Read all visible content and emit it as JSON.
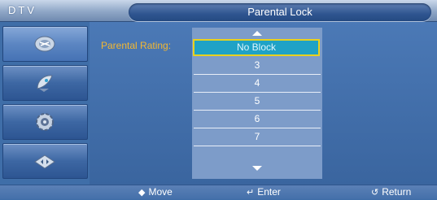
{
  "header": {
    "mode_label": "DTV",
    "title": "Parental Lock"
  },
  "sidebar": {
    "items": [
      {
        "icon": "satellite-dish-icon",
        "active": true
      },
      {
        "icon": "tv-antenna-icon",
        "active": false
      },
      {
        "icon": "gear-icon",
        "active": false
      },
      {
        "icon": "input-arrows-icon",
        "active": false
      }
    ]
  },
  "content": {
    "rating_label": "Parental Rating:",
    "options": [
      {
        "label": "No Block",
        "selected": true
      },
      {
        "label": "3",
        "selected": false
      },
      {
        "label": "4",
        "selected": false
      },
      {
        "label": "5",
        "selected": false
      },
      {
        "label": "6",
        "selected": false
      },
      {
        "label": "7",
        "selected": false
      }
    ],
    "scroll_up_icon": "chevron-up-icon",
    "scroll_down_icon": "chevron-down-icon"
  },
  "footer": {
    "move_label": "Move",
    "enter_label": "Enter",
    "return_label": "Return"
  },
  "colors": {
    "background": "#3f6ea8",
    "highlight": "#1fa2c6",
    "highlight_border": "#e9d11d",
    "label": "#f2b733"
  }
}
